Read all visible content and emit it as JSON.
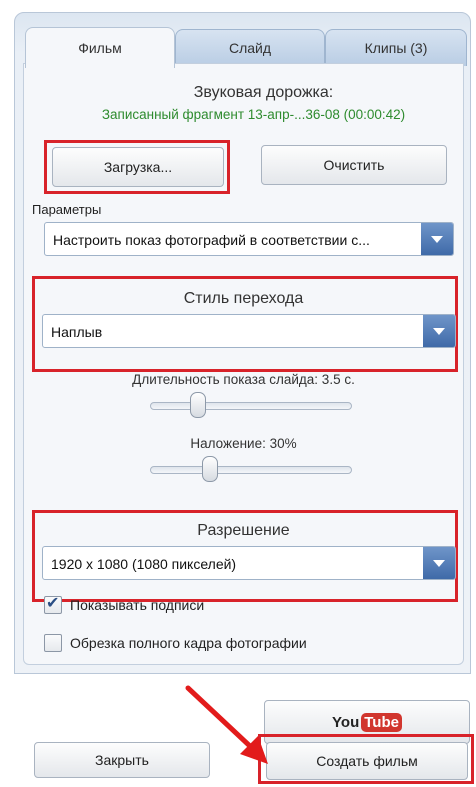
{
  "tabs": [
    {
      "label": "Фильм",
      "active": true
    },
    {
      "label": "Слайд",
      "active": false
    },
    {
      "label": "Клипы (3)",
      "active": false
    }
  ],
  "audio": {
    "title": "Звуковая дорожка:",
    "file": "Записанный фрагмент 13-апр-...36-08 (00:00:42)",
    "file_color": "#2e8b2e",
    "load_button": "Загрузка...",
    "clear_button": "Очистить"
  },
  "params": {
    "label": "Параметры",
    "value": "Настроить показ фотографий в соответствии с..."
  },
  "transition": {
    "title": "Стиль перехода",
    "value": "Наплыв"
  },
  "slide_duration": {
    "label": "Длительность показа слайда: 3.5 с.",
    "position": 0.35
  },
  "overlap": {
    "label": "Наложение: 30%",
    "position": 0.3
  },
  "resolution": {
    "title": "Разрешение",
    "value": "1920 x 1080 (1080 пикселей)"
  },
  "checkboxes": [
    {
      "label": "Показывать подписи",
      "checked": true
    },
    {
      "label": "Обрезка полного кадра фотографии",
      "checked": false
    }
  ],
  "youtube": {
    "you": "You",
    "tube": "Tube"
  },
  "footer": {
    "close_button": "Закрыть",
    "create_button": "Создать фильм"
  },
  "colors": {
    "highlight_red": "#d8232a",
    "arrow_red": "#e21b1b",
    "youtube_red": "#d1362e"
  }
}
